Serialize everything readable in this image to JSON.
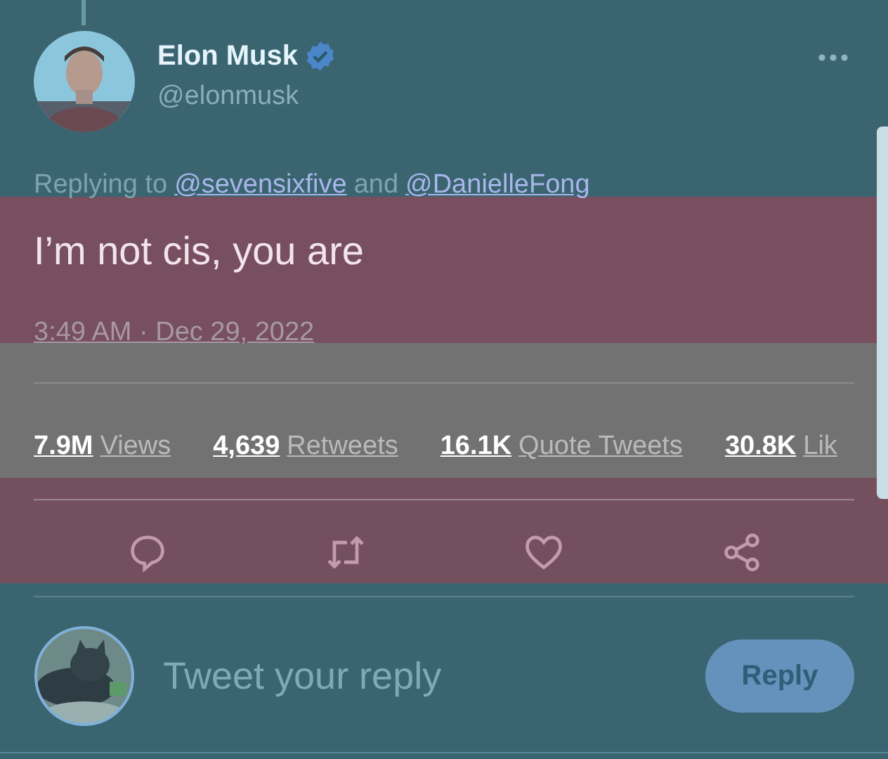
{
  "author": {
    "name": "Elon Musk",
    "handle": "@elonmusk",
    "verified": true
  },
  "replying_to": {
    "prefix": "Replying to",
    "users": [
      "@sevensixfive",
      "@DanielleFong"
    ],
    "joiner": "and"
  },
  "text": "I’m not cis, you are",
  "timestamp": "3:49 AM · Dec 29, 2022",
  "stats": [
    {
      "count": "7.9M",
      "label": "Views"
    },
    {
      "count": "4,639",
      "label": "Retweets"
    },
    {
      "count": "16.1K",
      "label": "Quote Tweets"
    },
    {
      "count": "30.8K",
      "label": "Lik"
    }
  ],
  "reply": {
    "placeholder": "Tweet your reply",
    "button": "Reply"
  }
}
